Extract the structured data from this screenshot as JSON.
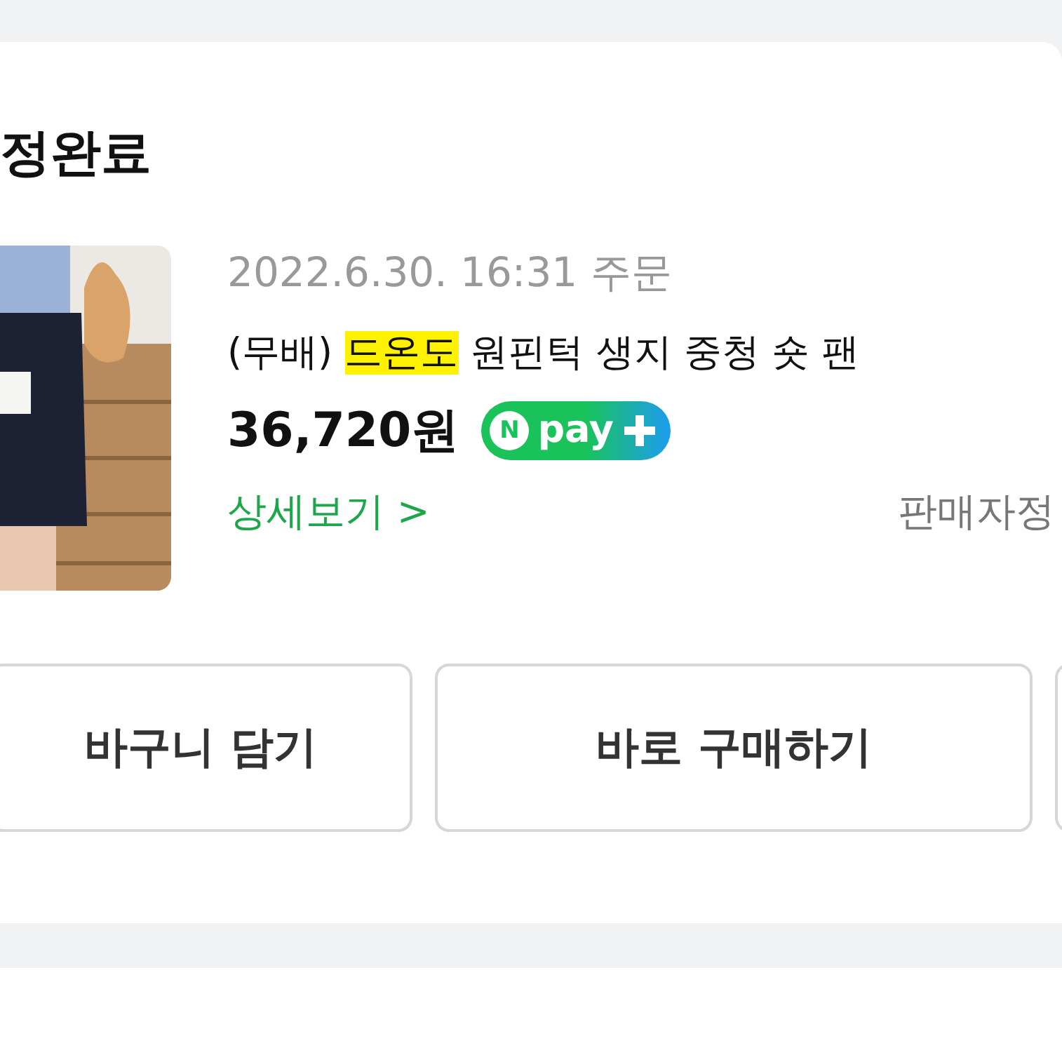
{
  "section_title": "정완료",
  "order": {
    "date": "2022.6.30. 16:31 주문",
    "product_name": {
      "prefix": "(무배) ",
      "highlight": "드온도",
      "suffix": " 원핀턱 생지 중청 숏 팬"
    },
    "price": "36,720원",
    "npay_badge": {
      "mark": "N",
      "label": "pay"
    },
    "details_link": "상세보기 >",
    "seller_info": "판매자정"
  },
  "buttons": [
    "바구니 담기",
    "바로 구매하기"
  ]
}
